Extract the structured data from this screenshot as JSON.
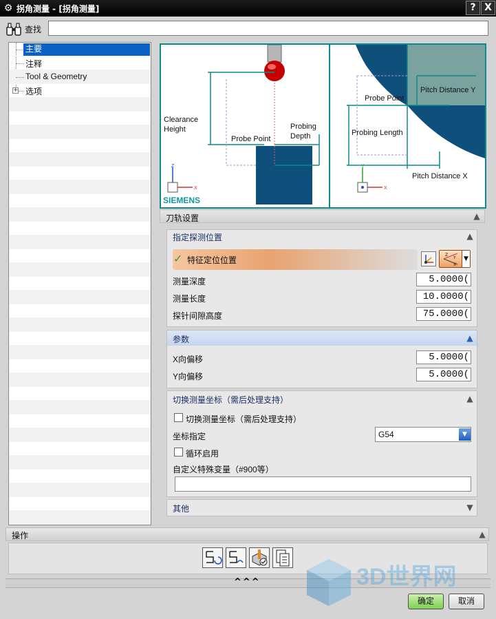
{
  "window": {
    "title": "拐角测量 - [拐角测量]",
    "help_label": "?",
    "close_label": "X"
  },
  "search": {
    "label": "查找",
    "value": ""
  },
  "tree": {
    "items": [
      {
        "label": "主要",
        "selected": true
      },
      {
        "label": "注释",
        "selected": false
      },
      {
        "label": "Tool & Geometry",
        "selected": false
      },
      {
        "label": "选项",
        "selected": false
      }
    ]
  },
  "diagram": {
    "left_labels": {
      "clearance_height": "Clearance Height",
      "clearance_height_line1": "Clearance",
      "clearance_height_line2": "Height",
      "probe_point": "Probe Point",
      "probing_depth_line1": "Probing",
      "probing_depth_line2": "Depth",
      "brand": "SIEMENS",
      "axis_z": "Z",
      "axis_x": "X"
    },
    "right_labels": {
      "probe_point": "Probe Point",
      "pitch_distance_y": "Pitch Distance Y",
      "probing_length": "Probing Length",
      "pitch_distance_x": "Pitch Distance X",
      "axis_y": "Y",
      "axis_x": "X"
    }
  },
  "path_settings": {
    "title": "刀轨设置"
  },
  "probe_position": {
    "title": "指定探测位置",
    "feature_label": "特征定位位置",
    "fields": [
      {
        "label": "测量深度",
        "value": "5.0000("
      },
      {
        "label": "测量长度",
        "value": "10.0000("
      },
      {
        "label": "探针间隙高度",
        "value": "75.0000("
      }
    ]
  },
  "params": {
    "title": "参数",
    "fields": [
      {
        "label": "X向偏移",
        "value": "5.0000("
      },
      {
        "label": "Y向偏移",
        "value": "5.0000("
      }
    ]
  },
  "coord_switch": {
    "title": "切换测量坐标（需后处理支持）",
    "checkbox_label": "切换测量坐标（需后处理支持）",
    "coord_label": "坐标指定",
    "coord_value": "G54",
    "loop_label": "循环启用",
    "custom_var_label": "自定义特殊变量（#900等）",
    "custom_var_value": ""
  },
  "other": {
    "title": "其他"
  },
  "operations": {
    "title": "操作"
  },
  "footer": {
    "expand_glyph": "^^^",
    "ok_label": "确定",
    "cancel_label": "取消",
    "watermark": "3D世界网"
  },
  "colors": {
    "accent_blue": "#0b62c4",
    "diagram_teal": "#0e8a8a",
    "diagram_navy": "#0f4f7c",
    "siemens": "#0f9b9b",
    "checkmark": "#2fa52f"
  }
}
